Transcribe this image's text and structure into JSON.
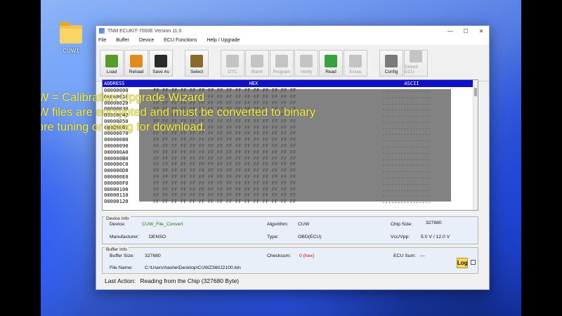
{
  "desktop": {
    "folder_label": "CUW1"
  },
  "window": {
    "title": "TNM ECUKIT-7000E   Version 11.0",
    "controls": [
      "—",
      "☐",
      "✕"
    ]
  },
  "menu": [
    "File",
    "Buffer",
    "Device",
    "ECU Functions",
    "Help / Upgrade"
  ],
  "toolbar": [
    {
      "label": "Load",
      "icon": "load-icon",
      "enabled": true,
      "color": "#5a9a2a"
    },
    {
      "label": "Reload",
      "icon": "reload-icon",
      "enabled": true,
      "color": "#e08a20"
    },
    {
      "label": "Save As",
      "icon": "save-icon",
      "enabled": true,
      "color": "#2a2a2a"
    },
    {
      "label": "Select",
      "icon": "select-icon",
      "enabled": true,
      "color": "#8a6a2a"
    },
    {
      "label": "DTC",
      "icon": "dtc-icon",
      "enabled": false,
      "color": "#c4c4c4"
    },
    {
      "label": "Blank",
      "icon": "blank-icon",
      "enabled": false,
      "color": "#c4c4c4"
    },
    {
      "label": "Program",
      "icon": "program-icon",
      "enabled": false,
      "color": "#c4c4c4"
    },
    {
      "label": "Verify",
      "icon": "verify-icon",
      "enabled": false,
      "color": "#c4c4c4"
    },
    {
      "label": "Read",
      "icon": "read-icon",
      "enabled": true,
      "color": "#3aa040"
    },
    {
      "label": "Erase",
      "icon": "erase-icon",
      "enabled": false,
      "color": "#c4c4c4"
    },
    {
      "label": "Config",
      "icon": "config-icon",
      "enabled": true,
      "color": "#7a7a7a"
    },
    {
      "label": "Detect ECU",
      "icon": "detect-ecu-icon",
      "enabled": false,
      "color": "#c4c4c4"
    }
  ],
  "hex": {
    "headers": {
      "address": "ADDRESS",
      "hex": "HEX",
      "ascii": "ASCII"
    },
    "rows": [
      {
        "addr": "00000000",
        "hex": "FF FF FF FF FF FF FF FF FF FF FF FF FF FF FF FF",
        "ascii": "................"
      },
      {
        "addr": "00000010",
        "hex": "FF FF FF FF FF FF FF FF FF FF FF FF FF FF FF FF",
        "ascii": "................"
      },
      {
        "addr": "00000020",
        "hex": "FF FF FF FF FF FF FF FF FF FF FF FF FF FF FF FF",
        "ascii": "................"
      },
      {
        "addr": "00000030",
        "hex": "FF FF FF FF FF FF FF FF FF FF FF FF FF FF FF FF",
        "ascii": "................"
      },
      {
        "addr": "00000040",
        "hex": "FF FF FF FF FF FF FF FF FF FF FF FF FF FF FF FF",
        "ascii": "................"
      },
      {
        "addr": "00000050",
        "hex": "FF FF FF FF FF FF FF FF FF FF FF FF FF FF FF FF",
        "ascii": "................"
      },
      {
        "addr": "00000060",
        "hex": "FF FF FF FF FF FF FF FF FF FF FF FF FF FF FF FF",
        "ascii": "................"
      },
      {
        "addr": "00000070",
        "hex": "FF FF FF FF FF FF FF FF FF FF FF FF FF FF FF FF",
        "ascii": "................"
      },
      {
        "addr": "00000080",
        "hex": "FF FF FF FF FF FF FF FF FF FF FF FF FF FF FF FF",
        "ascii": "................"
      },
      {
        "addr": "00000090",
        "hex": "FF FF FF FF FF FF FF FF FF FF FF FF FF FF FF FF",
        "ascii": "................"
      },
      {
        "addr": "000000A0",
        "hex": "FF FF FF FF FF FF FF FF FF FF FF FF FF FF FF FF",
        "ascii": "................"
      },
      {
        "addr": "000000B0",
        "hex": "FF FF FF FF FF FF FF FF FF FF FF FF FF FF FF FF",
        "ascii": "................"
      },
      {
        "addr": "000000C0",
        "hex": "FF FF FF FF FF FF FF FF FF FF FF FF FF FF FF FF",
        "ascii": "................"
      },
      {
        "addr": "000000D0",
        "hex": "FF FF FF FF FF FF FF FF FF FF FF FF FF FF FF FF",
        "ascii": "................"
      },
      {
        "addr": "000000E0",
        "hex": "FF FF FF FF FF FF FF FF FF FF FF FF FF FF FF FF",
        "ascii": "................"
      },
      {
        "addr": "000000F0",
        "hex": "FF FF FF FF FF FF FF FF FF FF FF FF FF FF FF FF",
        "ascii": "................"
      },
      {
        "addr": "00000100",
        "hex": "FF FF FF FF FF FF FF FF FF FF FF FF FF FF FF FF",
        "ascii": "................"
      },
      {
        "addr": "00000110",
        "hex": "FF FF FF FF FF FF FF FF FF FF FF FF FF FF FF FF",
        "ascii": "................"
      },
      {
        "addr": "00000120",
        "hex": "FF FF FF FF FF FF FF FF FF FF FF FF FF FF FF FF",
        "ascii": "................"
      }
    ]
  },
  "overlay": {
    "line1": "CUW = Calibration Upgrade Wizard",
    "line2": "CUW files are encrypted and must be converted to binary",
    "line3": "before tuning or using for download.",
    "color": "#f6f13a"
  },
  "device_info": {
    "title": "Device Info",
    "device_label": "Device:",
    "device": "CUW_File_Convert",
    "manufacturer_label": "Manufacturer:",
    "manufacturer": "DENSO",
    "algorithm_label": "Algorithm:",
    "algorithm": "CUW",
    "type_label": "Type:",
    "type": "OBD(ECU)",
    "chip_size_label": "Chip Size:",
    "chip_size": "327680",
    "vcc_label": "Vcc/Vpp:",
    "vcc": "5.0 V / 12.0 V"
  },
  "buffer_info": {
    "title": "Buffer Info",
    "size_label": "Buffer Size:",
    "size": "327680",
    "checksum_label": "Checksum:",
    "checksum": "0 (hex)",
    "ecu_sum_label": "ECU Sum:",
    "ecu_sum": "---",
    "file_label": "File Name:",
    "file": "C:\\Users\\hashe\\Desktop\\CUWZ360J2100.bin",
    "log_label": "Log"
  },
  "status": {
    "label": "Last Action:",
    "text": "Reading from the Chip  (327680 Byte)"
  }
}
